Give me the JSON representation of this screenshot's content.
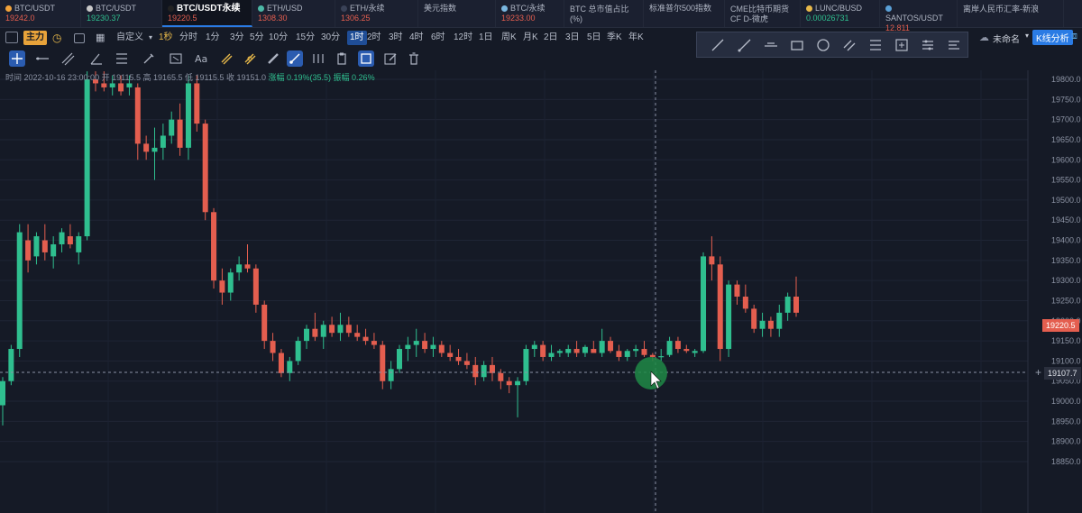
{
  "tickers": [
    {
      "name": "BTC/USDT",
      "price": "19242.0",
      "price_color": "#e45e4f",
      "icon_color": "#f2a33a"
    },
    {
      "name": "BTC/USDT",
      "price": "19230.37",
      "price_color": "#2fbf8f",
      "icon_color": "#c9c9c9"
    },
    {
      "name": "BTC/USDT永续",
      "price": "19220.5",
      "price_color": "#e45e4f",
      "icon_color": "#222"
    },
    {
      "name": "ETH/USD",
      "price": "1308.30",
      "price_color": "#e45e4f",
      "icon_color": "#4cb8a6"
    },
    {
      "name": "ETH/永续",
      "price": "1306.25",
      "price_color": "#e45e4f",
      "icon_color": "#3a4257"
    },
    {
      "name": "美元指数",
      "price": "",
      "price_color": "#e45e4f",
      "icon_color": ""
    },
    {
      "name": "BTC/永续",
      "price": "19233.00",
      "price_color": "#e45e4f",
      "icon_color": "#7ab7e0"
    },
    {
      "name": "BTC 总市值占比 (%)",
      "price": "",
      "price_color": "#e45e4f",
      "icon_color": ""
    },
    {
      "name": "标准普尔500指数",
      "price": "",
      "price_color": "#e45e4f",
      "icon_color": ""
    },
    {
      "name": "CME比特币期货CF D-微虎",
      "price": "",
      "price_color": "#e45e4f",
      "icon_color": ""
    },
    {
      "name": "LUNC/BUSD",
      "price": "0.00026731",
      "price_color": "#2fbf8f",
      "icon_color": "#e8b94a"
    },
    {
      "name": "SANTOS/USDT",
      "price": "12.811",
      "price_color": "#e45e4f",
      "icon_color": "#5aa0d6"
    },
    {
      "name": "离岸人民币汇率-新浪",
      "price": "",
      "price_color": "#e45e4f",
      "icon_color": ""
    }
  ],
  "interval_bar": {
    "main_tag": "主力",
    "custom": "自定义",
    "intervals": [
      "1秒",
      "分时",
      "1分",
      "3分",
      "5分",
      "10分",
      "15分",
      "30分",
      "1时",
      "2时",
      "3时",
      "4时",
      "6时",
      "12时",
      "1日",
      "周K",
      "月K",
      "2日",
      "3日",
      "5日",
      "季K",
      "年K"
    ],
    "active_interval": "1时",
    "highlight_interval": "1秒"
  },
  "right_controls": {
    "unnamed": "未命名",
    "kline_analysis": "K线分析"
  },
  "info_line": {
    "time": "时间 2022-10-16 23:00:00",
    "open": "开 19115.5",
    "high": "高 19165.5",
    "low": "低 19115.5",
    "close": "收 19151.0",
    "change": "涨幅 0.19%(35.5)",
    "amplitude": "振幅 0.26%"
  },
  "price_tags": {
    "last": "19220.5",
    "crosshair": "19107.7"
  },
  "chart_data": {
    "type": "candlestick",
    "y_ticks": [
      19800.0,
      19750.0,
      19700.0,
      19650.0,
      19600.0,
      19550.0,
      19500.0,
      19450.0,
      19400.0,
      19350.0,
      19300.0,
      19250.0,
      19200.0,
      19150.0,
      19100.0,
      19050.0,
      19000.0,
      18950.0,
      18900.0,
      18850.0
    ],
    "ylim": [
      18840,
      19815
    ],
    "grid": true,
    "up_color": "#2fbf8f",
    "down_color": "#e45e4f",
    "candles": [
      {
        "o": 18990,
        "h": 19060,
        "l": 18940,
        "c": 19050
      },
      {
        "o": 19050,
        "h": 19140,
        "l": 19040,
        "c": 19130
      },
      {
        "o": 19130,
        "h": 19440,
        "l": 19110,
        "c": 19420
      },
      {
        "o": 19400,
        "h": 19440,
        "l": 19320,
        "c": 19350
      },
      {
        "o": 19360,
        "h": 19420,
        "l": 19340,
        "c": 19410
      },
      {
        "o": 19400,
        "h": 19440,
        "l": 19350,
        "c": 19370
      },
      {
        "o": 19360,
        "h": 19410,
        "l": 19330,
        "c": 19390
      },
      {
        "o": 19390,
        "h": 19430,
        "l": 19370,
        "c": 19420
      },
      {
        "o": 19410,
        "h": 19440,
        "l": 19380,
        "c": 19390
      },
      {
        "o": 19370,
        "h": 19420,
        "l": 19340,
        "c": 19410
      },
      {
        "o": 19410,
        "h": 19820,
        "l": 19400,
        "c": 19800
      },
      {
        "o": 19800,
        "h": 19820,
        "l": 19770,
        "c": 19790
      },
      {
        "o": 19790,
        "h": 19820,
        "l": 19770,
        "c": 19780
      },
      {
        "o": 19780,
        "h": 19810,
        "l": 19760,
        "c": 19790
      },
      {
        "o": 19790,
        "h": 19810,
        "l": 19760,
        "c": 19770
      },
      {
        "o": 19780,
        "h": 19810,
        "l": 19760,
        "c": 19790
      },
      {
        "o": 19780,
        "h": 19790,
        "l": 19600,
        "c": 19640
      },
      {
        "o": 19640,
        "h": 19660,
        "l": 19600,
        "c": 19620
      },
      {
        "o": 19620,
        "h": 19680,
        "l": 19550,
        "c": 19630
      },
      {
        "o": 19630,
        "h": 19690,
        "l": 19600,
        "c": 19660
      },
      {
        "o": 19660,
        "h": 19720,
        "l": 19640,
        "c": 19700
      },
      {
        "o": 19700,
        "h": 19740,
        "l": 19610,
        "c": 19630
      },
      {
        "o": 19630,
        "h": 19810,
        "l": 19600,
        "c": 19790
      },
      {
        "o": 19790,
        "h": 19810,
        "l": 19670,
        "c": 19690
      },
      {
        "o": 19690,
        "h": 19700,
        "l": 19450,
        "c": 19470
      },
      {
        "o": 19470,
        "h": 19480,
        "l": 19280,
        "c": 19300
      },
      {
        "o": 19300,
        "h": 19330,
        "l": 19240,
        "c": 19270
      },
      {
        "o": 19270,
        "h": 19330,
        "l": 19250,
        "c": 19320
      },
      {
        "o": 19320,
        "h": 19360,
        "l": 19300,
        "c": 19340
      },
      {
        "o": 19340,
        "h": 19390,
        "l": 19320,
        "c": 19330
      },
      {
        "o": 19330,
        "h": 19340,
        "l": 19220,
        "c": 19240
      },
      {
        "o": 19240,
        "h": 19250,
        "l": 19130,
        "c": 19150
      },
      {
        "o": 19150,
        "h": 19170,
        "l": 19100,
        "c": 19120
      },
      {
        "o": 19120,
        "h": 19130,
        "l": 19060,
        "c": 19070
      },
      {
        "o": 19070,
        "h": 19110,
        "l": 19050,
        "c": 19100
      },
      {
        "o": 19100,
        "h": 19160,
        "l": 19090,
        "c": 19150
      },
      {
        "o": 19150,
        "h": 19190,
        "l": 19130,
        "c": 19180
      },
      {
        "o": 19180,
        "h": 19220,
        "l": 19150,
        "c": 19160
      },
      {
        "o": 19160,
        "h": 19200,
        "l": 19130,
        "c": 19190
      },
      {
        "o": 19190,
        "h": 19210,
        "l": 19160,
        "c": 19170
      },
      {
        "o": 19170,
        "h": 19220,
        "l": 19150,
        "c": 19190
      },
      {
        "o": 19190,
        "h": 19210,
        "l": 19160,
        "c": 19170
      },
      {
        "o": 19170,
        "h": 19190,
        "l": 19150,
        "c": 19160
      },
      {
        "o": 19160,
        "h": 19180,
        "l": 19140,
        "c": 19150
      },
      {
        "o": 19150,
        "h": 19170,
        "l": 19130,
        "c": 19140
      },
      {
        "o": 19140,
        "h": 19150,
        "l": 19030,
        "c": 19050
      },
      {
        "o": 19050,
        "h": 19100,
        "l": 19030,
        "c": 19080
      },
      {
        "o": 19080,
        "h": 19140,
        "l": 19070,
        "c": 19130
      },
      {
        "o": 19130,
        "h": 19160,
        "l": 19100,
        "c": 19140
      },
      {
        "o": 19140,
        "h": 19180,
        "l": 19110,
        "c": 19150
      },
      {
        "o": 19150,
        "h": 19170,
        "l": 19120,
        "c": 19130
      },
      {
        "o": 19130,
        "h": 19160,
        "l": 19110,
        "c": 19140
      },
      {
        "o": 19140,
        "h": 19150,
        "l": 19110,
        "c": 19120
      },
      {
        "o": 19120,
        "h": 19140,
        "l": 19100,
        "c": 19110
      },
      {
        "o": 19110,
        "h": 19130,
        "l": 19090,
        "c": 19100
      },
      {
        "o": 19100,
        "h": 19120,
        "l": 19080,
        "c": 19090
      },
      {
        "o": 19090,
        "h": 19110,
        "l": 19040,
        "c": 19060
      },
      {
        "o": 19060,
        "h": 19100,
        "l": 19050,
        "c": 19090
      },
      {
        "o": 19090,
        "h": 19110,
        "l": 19050,
        "c": 19070
      },
      {
        "o": 19070,
        "h": 19080,
        "l": 19030,
        "c": 19050
      },
      {
        "o": 19050,
        "h": 19060,
        "l": 19020,
        "c": 19040
      },
      {
        "o": 19040,
        "h": 19060,
        "l": 18960,
        "c": 19050
      },
      {
        "o": 19050,
        "h": 19140,
        "l": 19040,
        "c": 19130
      },
      {
        "o": 19130,
        "h": 19150,
        "l": 19110,
        "c": 19140
      },
      {
        "o": 19140,
        "h": 19150,
        "l": 19100,
        "c": 19110
      },
      {
        "o": 19110,
        "h": 19140,
        "l": 19100,
        "c": 19120
      },
      {
        "o": 19120,
        "h": 19130,
        "l": 19110,
        "c": 19125
      },
      {
        "o": 19120,
        "h": 19140,
        "l": 19110,
        "c": 19130
      },
      {
        "o": 19130,
        "h": 19150,
        "l": 19110,
        "c": 19120
      },
      {
        "o": 19120,
        "h": 19140,
        "l": 19110,
        "c": 19135
      },
      {
        "o": 19130,
        "h": 19150,
        "l": 19120,
        "c": 19120
      },
      {
        "o": 19120,
        "h": 19180,
        "l": 19110,
        "c": 19150
      },
      {
        "o": 19150,
        "h": 19160,
        "l": 19120,
        "c": 19125
      },
      {
        "o": 19125,
        "h": 19140,
        "l": 19100,
        "c": 19110
      },
      {
        "o": 19110,
        "h": 19130,
        "l": 19100,
        "c": 19125
      },
      {
        "o": 19125,
        "h": 19140,
        "l": 19110,
        "c": 19130
      },
      {
        "o": 19130,
        "h": 19150,
        "l": 19110,
        "c": 19115
      },
      {
        "o": 19115,
        "h": 19120,
        "l": 19100,
        "c": 19110
      },
      {
        "o": 19110,
        "h": 19130,
        "l": 19100,
        "c": 19112
      },
      {
        "o": 19115,
        "h": 19160,
        "l": 19110,
        "c": 19150
      },
      {
        "o": 19150,
        "h": 19160,
        "l": 19120,
        "c": 19130
      },
      {
        "o": 19130,
        "h": 19140,
        "l": 19120,
        "c": 19125
      },
      {
        "o": 19120,
        "h": 19130,
        "l": 19110,
        "c": 19125
      },
      {
        "o": 19125,
        "h": 19370,
        "l": 19120,
        "c": 19360
      },
      {
        "o": 19360,
        "h": 19410,
        "l": 19300,
        "c": 19340
      },
      {
        "o": 19340,
        "h": 19360,
        "l": 19100,
        "c": 19130
      },
      {
        "o": 19130,
        "h": 19300,
        "l": 19110,
        "c": 19290
      },
      {
        "o": 19290,
        "h": 19300,
        "l": 19240,
        "c": 19260
      },
      {
        "o": 19260,
        "h": 19290,
        "l": 19220,
        "c": 19230
      },
      {
        "o": 19230,
        "h": 19240,
        "l": 19170,
        "c": 19180
      },
      {
        "o": 19180,
        "h": 19220,
        "l": 19160,
        "c": 19200
      },
      {
        "o": 19200,
        "h": 19210,
        "l": 19160,
        "c": 19180
      },
      {
        "o": 19180,
        "h": 19240,
        "l": 19160,
        "c": 19220
      },
      {
        "o": 19220,
        "h": 19270,
        "l": 19200,
        "c": 19260
      },
      {
        "o": 19260,
        "h": 19310,
        "l": 19210,
        "c": 19220
      }
    ]
  }
}
